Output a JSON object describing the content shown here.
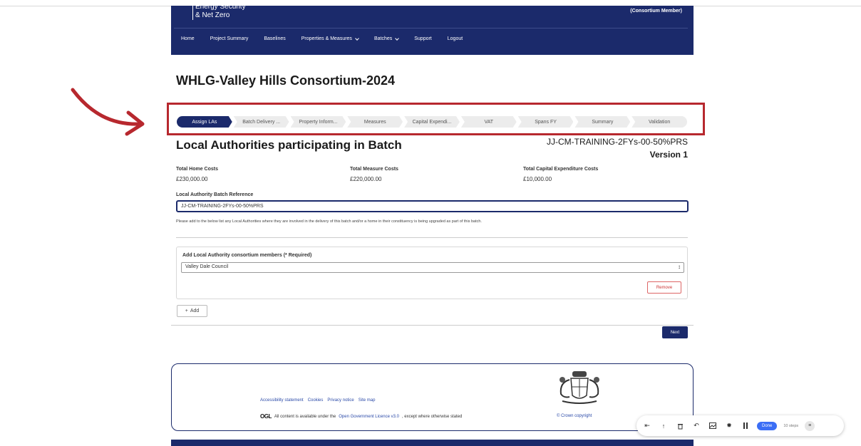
{
  "header": {
    "department_lines": [
      "Energy Security",
      "& Net Zero"
    ],
    "member_role": "(Consortium Member)",
    "nav": [
      {
        "label": "Home",
        "dropdown": false
      },
      {
        "label": "Project Summary",
        "dropdown": false
      },
      {
        "label": "Baselines",
        "dropdown": false
      },
      {
        "label": "Properties & Measures",
        "dropdown": true
      },
      {
        "label": "Batches",
        "dropdown": true
      },
      {
        "label": "Support",
        "dropdown": false
      },
      {
        "label": "Logout",
        "dropdown": false
      }
    ]
  },
  "page_title": "WHLG-Valley Hills Consortium-2024",
  "stepper": {
    "steps": [
      "Assign LAs",
      "Batch Delivery ...",
      "Property Inform...",
      "Measures",
      "Capital Expendi...",
      "VAT",
      "Spans FY",
      "Summary",
      "Validation"
    ],
    "active_index": 0
  },
  "section": {
    "title": "Local Authorities participating in Batch",
    "batch_reference": "JJ-CM-TRAINING-2FYs-00-50%PRS",
    "version": "Version 1"
  },
  "costs": {
    "home_label": "Total Home Costs",
    "home_value": "£230,000.00",
    "measure_label": "Total Measure Costs",
    "measure_value": "£220,000.00",
    "capex_label": "Total Capital Expenditure Costs",
    "capex_value": "£10,000.00"
  },
  "form": {
    "ref_label": "Local Authority Batch Reference",
    "ref_value": "JJ-CM-TRAINING-2FYs-00-50%PRS",
    "help_text": "Please add to the below list any Local Authorities where they are involved in the delivery of this batch and/or a home in their constituency is being upgraded as part of this batch.",
    "la_label": "Add Local Authority consortium members (* Required)",
    "la_selected": "Valley Dale Council",
    "remove_label": "Remove",
    "add_label": "Add",
    "next_label": "Next"
  },
  "footer": {
    "links": [
      "Accessibility statement",
      "Cookies",
      "Privacy notice",
      "Site map"
    ],
    "ogl_logo": "OGL",
    "licence_prefix": "All content is available under the",
    "licence_link": "Open Government Licence v3.0",
    "licence_suffix": ", except where otherwise stated",
    "copyright": "© Crown copyright"
  },
  "recorder": {
    "done_label": "Done",
    "steps_label": "10 steps",
    "icons": [
      "skip-to-start-icon",
      "upload-icon",
      "trash-icon",
      "undo-icon",
      "image-icon",
      "settings-icon",
      "pause-icon"
    ]
  },
  "colors": {
    "brand_navy": "#1b2a6b",
    "highlight_red": "#b7282e",
    "link_blue": "#2b4aa8",
    "recorder_blue": "#3b6ef5"
  }
}
